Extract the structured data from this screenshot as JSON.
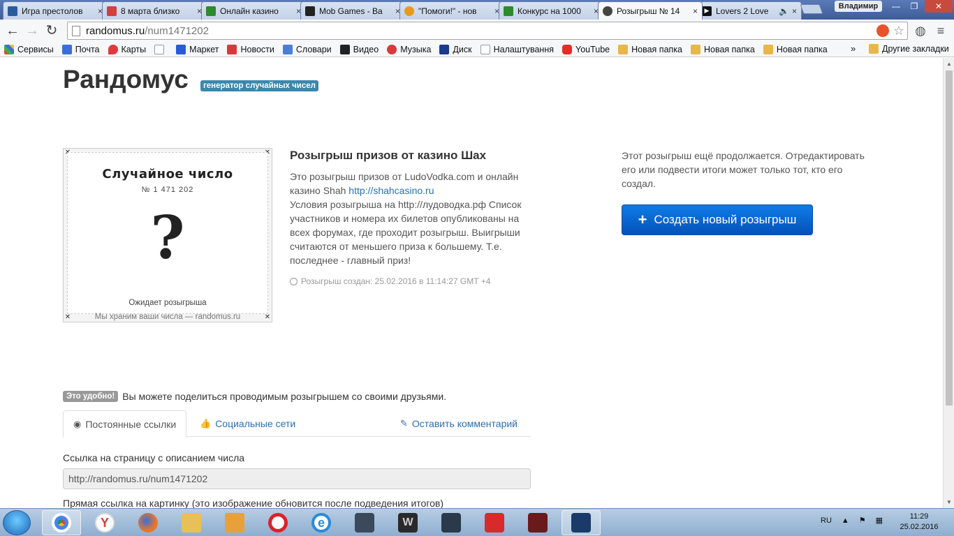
{
  "browser": {
    "tabs": [
      {
        "title": "Игра престолов",
        "color": "#2a5c9a"
      },
      {
        "title": "8 марта близко",
        "color": "#d23f3f"
      },
      {
        "title": "Онлайн казино",
        "color": "#2d8a2d"
      },
      {
        "title": "Mob Games - Ва",
        "color": "#222222"
      },
      {
        "title": "\"Помоги!\" - нов",
        "color": "#e89b1a"
      },
      {
        "title": "Конкурс на 1000",
        "color": "#2d8a2d"
      },
      {
        "title": "Розыгрыш № 14",
        "color": "#444444"
      },
      {
        "title": "Lovers 2 Love",
        "color": "#111111"
      }
    ],
    "user": "Владимир",
    "url_domain": "randomus.ru",
    "url_path": "/num1471202",
    "bookmarks": [
      {
        "label": "Сервисы",
        "color": "#e04a3a"
      },
      {
        "label": "Почта",
        "color": "#3a6fd8"
      },
      {
        "label": "Карты",
        "color": "#e03a3a"
      },
      {
        "label": "",
        "color": "#ffffff"
      },
      {
        "label": "Маркет",
        "color": "#2a5ad8"
      },
      {
        "label": "Новости",
        "color": "#d83a3a"
      },
      {
        "label": "Словари",
        "color": "#4a7fd8"
      },
      {
        "label": "Видео",
        "color": "#222222"
      },
      {
        "label": "Музыка",
        "color": "#d83a3a"
      },
      {
        "label": "Диск",
        "color": "#1a3a8a"
      },
      {
        "label": "Налаштування",
        "color": "#ffffff"
      },
      {
        "label": "YouTube",
        "color": "#e52d27"
      },
      {
        "label": "Новая папка",
        "color": "#e8b74a"
      },
      {
        "label": "Новая папка",
        "color": "#e8b74a"
      },
      {
        "label": "Новая папка",
        "color": "#e8b74a"
      }
    ],
    "bookmarks_more": "»",
    "other_bookmarks": "Другие закладки"
  },
  "site": {
    "logo": "Рандомус",
    "tagline": "генератор случайных чисел"
  },
  "card": {
    "title": "Случайное число",
    "number": "№ 1 471 202",
    "symbol": "?",
    "status": "Ожидает розыгрыша",
    "footer": "Мы храним ваши числа — randomus.ru"
  },
  "lottery": {
    "title": "Розыгрыш призов от казино Шах",
    "desc_part1": "Это розыгрыш призов от LudoVodka.com и онлайн казино Shah ",
    "desc_link": "http://shahcasino.ru",
    "desc_part2": "Условия розыгрыша на http://лудоводка.рф Список участников и номера их билетов опубликованы на всех форумах, где проходит розыгрыш. Выигрыши считаются от меньшего приза к большему. Т.е. последнее - главный приз!",
    "created": "Розыгрыш создан: 25.02.2016 в 11:14:27 GMT +4"
  },
  "right": {
    "note": "Этот розыгрыш ещё продолжается. Отредактировать его или подвести итоги может только тот, кто его создал.",
    "create_button": "Создать новый розыгрыш"
  },
  "share": {
    "badge": "Это удобно!",
    "text": "Вы можете поделиться проводимым розыгрышем со своими друзьями.",
    "tabs": [
      {
        "label": "Постоянные ссылки"
      },
      {
        "label": "Социальные сети"
      },
      {
        "label": "Оставить комментарий"
      }
    ],
    "link_label": "Ссылка на страницу с описанием числа",
    "link_value": "http://randomus.ru/num1471202",
    "image_label": "Прямая ссылка на картинку (это изображение обновится после подведения итогов)"
  },
  "taskbar": {
    "lang": "RU",
    "time": "11:29",
    "date": "25.02.2016"
  },
  "colors": {
    "accent": "#3a87ad",
    "button": "#0562c8",
    "link": "#2a6fb5"
  }
}
